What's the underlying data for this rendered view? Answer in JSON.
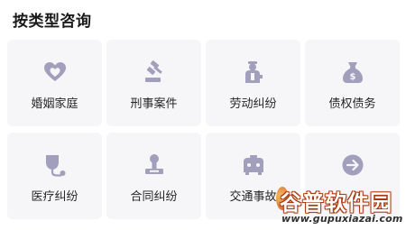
{
  "section": {
    "title": "按类型咨询"
  },
  "categories": [
    {
      "label": "婚姻家庭",
      "icon": "heart-icon"
    },
    {
      "label": "刑事案件",
      "icon": "gavel-icon"
    },
    {
      "label": "劳动纠纷",
      "icon": "worker-icon"
    },
    {
      "label": "债权债务",
      "icon": "money-bag-icon"
    },
    {
      "label": "医疗纠纷",
      "icon": "stethoscope-icon"
    },
    {
      "label": "合同纠纷",
      "icon": "stamp-icon"
    },
    {
      "label": "交通事故",
      "icon": "vehicle-icon"
    },
    {
      "label": "",
      "icon": "arrow-right-icon"
    }
  ],
  "watermark": {
    "brand": "谷普软件园",
    "url": "www.gupuxiazai.com"
  },
  "colors": {
    "icon": "#9b98b6",
    "card_bg": "#f6f6f8",
    "text": "#262626"
  }
}
